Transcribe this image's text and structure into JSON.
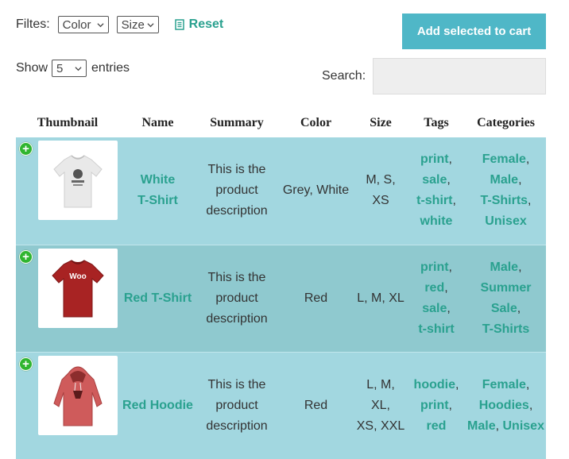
{
  "filters": {
    "label": "Filtes:",
    "color_value": "Color",
    "size_value": "Size",
    "reset_label": "Reset"
  },
  "add_button_label": "Add selected to cart",
  "show": {
    "prefix": "Show",
    "value": "5",
    "suffix": "entries"
  },
  "search": {
    "label": "Search:",
    "value": "",
    "placeholder": ""
  },
  "table": {
    "headers": {
      "thumbnail": "Thumbnail",
      "name": "Name",
      "summary": "Summary",
      "color": "Color",
      "size": "Size",
      "tags": "Tags",
      "categories": "Categories"
    },
    "rows": [
      {
        "thumbnail": "grey-tshirt-image",
        "name_line1": "White",
        "name_line2": "T-Shirt",
        "summary_1": "This is the",
        "summary_2": "product",
        "summary_3": "description",
        "color": "Grey, White",
        "size_1": "M, S, XS",
        "size_2": "",
        "tags": [
          "print",
          "sale",
          "t-shirt",
          "white"
        ],
        "categories": [
          "Female",
          "Male",
          "T-Shirts",
          "Unisex"
        ]
      },
      {
        "thumbnail": "red-tshirt-image",
        "name_line1": "Red T-Shirt",
        "name_line2": "",
        "summary_1": "This is the",
        "summary_2": "product",
        "summary_3": "description",
        "color": "Red",
        "size_1": "L, M, XL",
        "size_2": "",
        "tags": [
          "print",
          "red",
          "sale",
          "t-shirt"
        ],
        "categories": [
          "Male",
          "Summer",
          "Sale",
          "T-Shirts"
        ]
      },
      {
        "thumbnail": "red-hoodie-image",
        "name_line1": "Red Hoodie",
        "name_line2": "",
        "summary_1": "This is the",
        "summary_2": "product",
        "summary_3": "description",
        "color": "Red",
        "size_1": "L, M, XL,",
        "size_2": "XS, XXL",
        "tags": [
          "hoodie",
          "print",
          "red"
        ],
        "categories": [
          "Female",
          "Hoodies",
          "Male",
          "Unisex"
        ]
      }
    ],
    "tshirt_logo_text": "Woo"
  },
  "colors": {
    "accent_teal": "#2aa18f",
    "button_bg": "#4fb7c7",
    "row_odd": "#a2d7e0",
    "row_even": "#8fc9cf",
    "add_icon_green": "#2fb52f"
  }
}
